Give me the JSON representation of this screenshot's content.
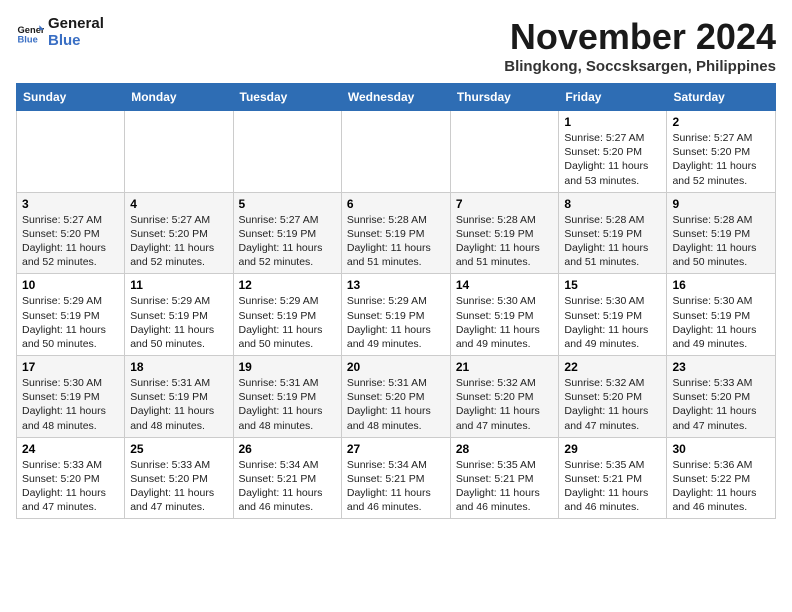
{
  "logo": {
    "line1": "General",
    "line2": "Blue"
  },
  "title": "November 2024",
  "location": "Blingkong, Soccsksargen, Philippines",
  "weekdays": [
    "Sunday",
    "Monday",
    "Tuesday",
    "Wednesday",
    "Thursday",
    "Friday",
    "Saturday"
  ],
  "weeks": [
    [
      null,
      null,
      null,
      null,
      null,
      {
        "day": "1",
        "sunrise": "5:27 AM",
        "sunset": "5:20 PM",
        "daylight": "11 hours and 53 minutes."
      },
      {
        "day": "2",
        "sunrise": "5:27 AM",
        "sunset": "5:20 PM",
        "daylight": "11 hours and 52 minutes."
      }
    ],
    [
      {
        "day": "3",
        "sunrise": "5:27 AM",
        "sunset": "5:20 PM",
        "daylight": "11 hours and 52 minutes."
      },
      {
        "day": "4",
        "sunrise": "5:27 AM",
        "sunset": "5:20 PM",
        "daylight": "11 hours and 52 minutes."
      },
      {
        "day": "5",
        "sunrise": "5:27 AM",
        "sunset": "5:19 PM",
        "daylight": "11 hours and 52 minutes."
      },
      {
        "day": "6",
        "sunrise": "5:28 AM",
        "sunset": "5:19 PM",
        "daylight": "11 hours and 51 minutes."
      },
      {
        "day": "7",
        "sunrise": "5:28 AM",
        "sunset": "5:19 PM",
        "daylight": "11 hours and 51 minutes."
      },
      {
        "day": "8",
        "sunrise": "5:28 AM",
        "sunset": "5:19 PM",
        "daylight": "11 hours and 51 minutes."
      },
      {
        "day": "9",
        "sunrise": "5:28 AM",
        "sunset": "5:19 PM",
        "daylight": "11 hours and 50 minutes."
      }
    ],
    [
      {
        "day": "10",
        "sunrise": "5:29 AM",
        "sunset": "5:19 PM",
        "daylight": "11 hours and 50 minutes."
      },
      {
        "day": "11",
        "sunrise": "5:29 AM",
        "sunset": "5:19 PM",
        "daylight": "11 hours and 50 minutes."
      },
      {
        "day": "12",
        "sunrise": "5:29 AM",
        "sunset": "5:19 PM",
        "daylight": "11 hours and 50 minutes."
      },
      {
        "day": "13",
        "sunrise": "5:29 AM",
        "sunset": "5:19 PM",
        "daylight": "11 hours and 49 minutes."
      },
      {
        "day": "14",
        "sunrise": "5:30 AM",
        "sunset": "5:19 PM",
        "daylight": "11 hours and 49 minutes."
      },
      {
        "day": "15",
        "sunrise": "5:30 AM",
        "sunset": "5:19 PM",
        "daylight": "11 hours and 49 minutes."
      },
      {
        "day": "16",
        "sunrise": "5:30 AM",
        "sunset": "5:19 PM",
        "daylight": "11 hours and 49 minutes."
      }
    ],
    [
      {
        "day": "17",
        "sunrise": "5:30 AM",
        "sunset": "5:19 PM",
        "daylight": "11 hours and 48 minutes."
      },
      {
        "day": "18",
        "sunrise": "5:31 AM",
        "sunset": "5:19 PM",
        "daylight": "11 hours and 48 minutes."
      },
      {
        "day": "19",
        "sunrise": "5:31 AM",
        "sunset": "5:19 PM",
        "daylight": "11 hours and 48 minutes."
      },
      {
        "day": "20",
        "sunrise": "5:31 AM",
        "sunset": "5:20 PM",
        "daylight": "11 hours and 48 minutes."
      },
      {
        "day": "21",
        "sunrise": "5:32 AM",
        "sunset": "5:20 PM",
        "daylight": "11 hours and 47 minutes."
      },
      {
        "day": "22",
        "sunrise": "5:32 AM",
        "sunset": "5:20 PM",
        "daylight": "11 hours and 47 minutes."
      },
      {
        "day": "23",
        "sunrise": "5:33 AM",
        "sunset": "5:20 PM",
        "daylight": "11 hours and 47 minutes."
      }
    ],
    [
      {
        "day": "24",
        "sunrise": "5:33 AM",
        "sunset": "5:20 PM",
        "daylight": "11 hours and 47 minutes."
      },
      {
        "day": "25",
        "sunrise": "5:33 AM",
        "sunset": "5:20 PM",
        "daylight": "11 hours and 47 minutes."
      },
      {
        "day": "26",
        "sunrise": "5:34 AM",
        "sunset": "5:21 PM",
        "daylight": "11 hours and 46 minutes."
      },
      {
        "day": "27",
        "sunrise": "5:34 AM",
        "sunset": "5:21 PM",
        "daylight": "11 hours and 46 minutes."
      },
      {
        "day": "28",
        "sunrise": "5:35 AM",
        "sunset": "5:21 PM",
        "daylight": "11 hours and 46 minutes."
      },
      {
        "day": "29",
        "sunrise": "5:35 AM",
        "sunset": "5:21 PM",
        "daylight": "11 hours and 46 minutes."
      },
      {
        "day": "30",
        "sunrise": "5:36 AM",
        "sunset": "5:22 PM",
        "daylight": "11 hours and 46 minutes."
      }
    ]
  ]
}
